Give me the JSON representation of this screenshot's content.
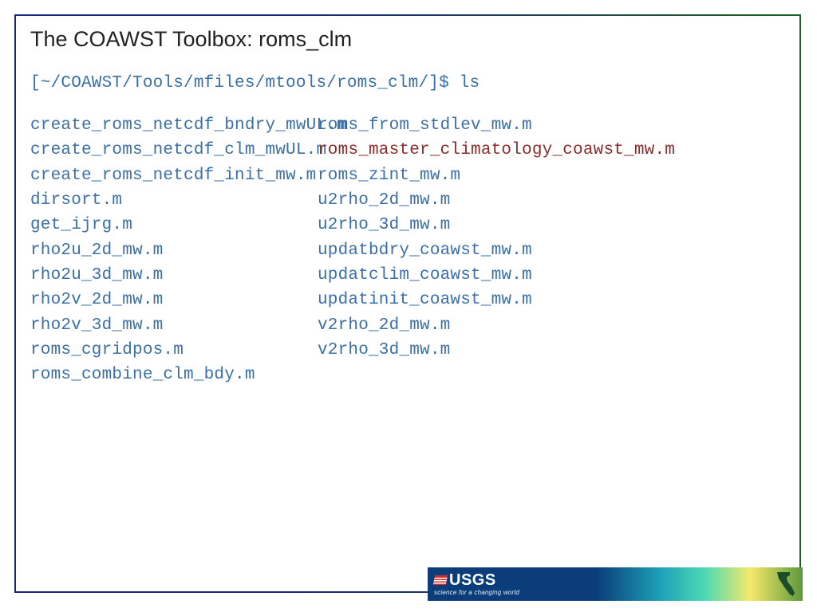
{
  "title": "The COAWST Toolbox: roms_clm",
  "prompt": "[~/COAWST/Tools/mfiles/mtools/roms_clm/]$ ls",
  "files": {
    "col1": [
      "create_roms_netcdf_bndry_mwUL.m",
      "create_roms_netcdf_clm_mwUL.m",
      "create_roms_netcdf_init_mw.m",
      "dirsort.m",
      "get_ijrg.m",
      "rho2u_2d_mw.m",
      "rho2u_3d_mw.m",
      "rho2v_2d_mw.m",
      "rho2v_3d_mw.m",
      "roms_cgridpos.m",
      "roms_combine_clm_bdy.m"
    ],
    "col2": [
      {
        "name": "roms_from_stdlev_mw.m",
        "highlight": false
      },
      {
        "name": "roms_master_climatology_coawst_mw.m",
        "highlight": true
      },
      {
        "name": "roms_zint_mw.m",
        "highlight": false
      },
      {
        "name": "u2rho_2d_mw.m",
        "highlight": false
      },
      {
        "name": "u2rho_3d_mw.m",
        "highlight": false
      },
      {
        "name": "updatbdry_coawst_mw.m",
        "highlight": false
      },
      {
        "name": "updatclim_coawst_mw.m",
        "highlight": false
      },
      {
        "name": "updatinit_coawst_mw.m",
        "highlight": false
      },
      {
        "name": "v2rho_2d_mw.m",
        "highlight": false
      },
      {
        "name": "v2rho_3d_mw.m",
        "highlight": false
      }
    ]
  },
  "footer": {
    "org": "USGS",
    "tagline": "science for a changing world"
  }
}
